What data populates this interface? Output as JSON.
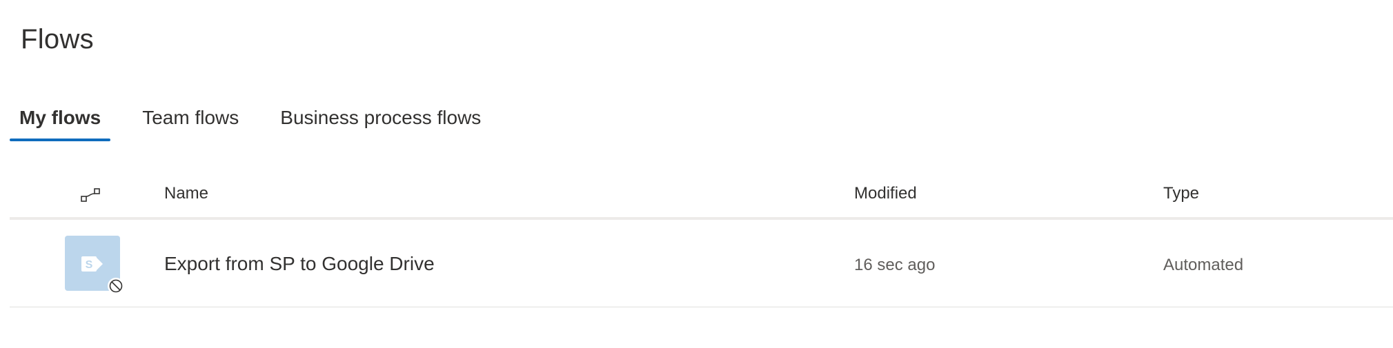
{
  "page": {
    "title": "Flows"
  },
  "tabs": [
    {
      "label": "My flows",
      "active": true
    },
    {
      "label": "Team flows",
      "active": false
    },
    {
      "label": "Business process flows",
      "active": false
    }
  ],
  "table": {
    "header_icon": "flow-icon",
    "columns": [
      "Name",
      "Modified",
      "Type"
    ],
    "rows": [
      {
        "icon": "sharepoint-icon",
        "status_icon": "disabled-icon",
        "name": "Export from SP to Google Drive",
        "modified": "16 sec ago",
        "type": "Automated"
      }
    ]
  },
  "colors": {
    "accent": "#0f6cbd",
    "row_icon_bg": "#bcd6ec",
    "text": "#323130",
    "secondary_text": "#605e5c"
  }
}
